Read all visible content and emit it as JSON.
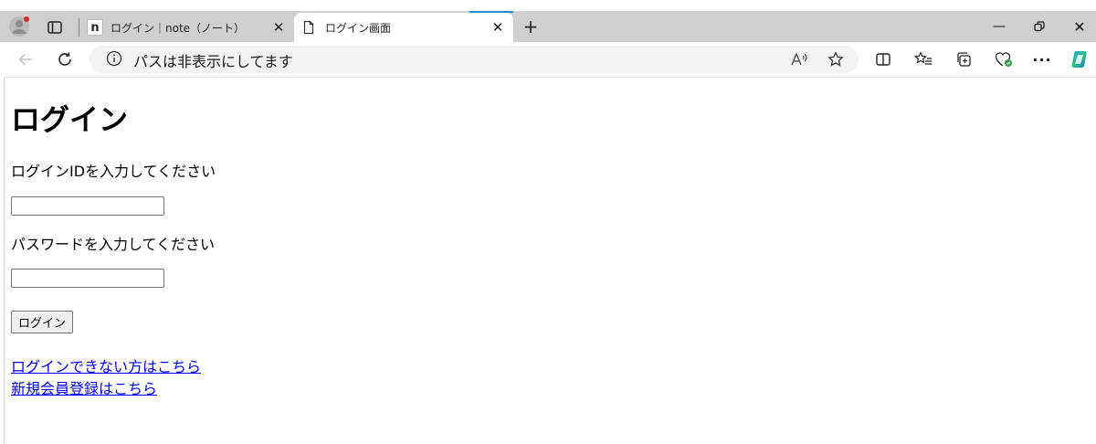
{
  "browser": {
    "tabs": [
      {
        "label": "ログイン｜note（ノート）",
        "favicon": "n",
        "active": false
      },
      {
        "label": "ログイン画面",
        "favicon": "document-icon",
        "active": true
      }
    ],
    "address_bar": {
      "text": "パスは非表示にしてます"
    },
    "colors": {
      "tabstrip": "#cfcfcf",
      "active_tab": "#ffffff",
      "accent": "#2b88d8"
    }
  },
  "page": {
    "title": "ログイン",
    "login_id_label": "ログインIDを入力してください",
    "login_id_value": "",
    "password_label": "パスワードを入力してください",
    "password_value": "",
    "submit_label": "ログイン",
    "links": [
      {
        "text": "ログインできない方はこちら"
      },
      {
        "text": "新規会員登録はこちら"
      }
    ],
    "colors": {
      "link": "#0000ee"
    }
  }
}
